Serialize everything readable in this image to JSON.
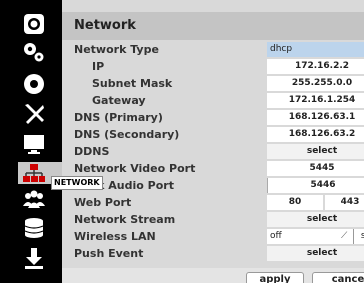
{
  "sidebar": {
    "tooltip": "NETWORK",
    "icons": [
      "camera-icon",
      "gears-icon",
      "record-icon",
      "tools-icon",
      "monitor-icon",
      "network-icon",
      "users-icon",
      "storage-icon",
      "download-icon"
    ]
  },
  "panel": {
    "title": "Network",
    "rows": [
      {
        "label": "Network Type",
        "value": "dhcp"
      },
      {
        "label": "IP",
        "value": "172.16.2.2"
      },
      {
        "label": "Subnet Mask",
        "value": "255.255.0.0"
      },
      {
        "label": "Gateway",
        "value": "172.16.1.254"
      },
      {
        "label": "DNS (Primary)",
        "value": "168.126.63.1"
      },
      {
        "label": "DNS (Secondary)",
        "value": "168.126.63.2"
      },
      {
        "label": "DDNS",
        "value": "select"
      },
      {
        "label": "Network Video Port",
        "value": "5445"
      },
      {
        "label": "work Audio Port",
        "value": "5446"
      },
      {
        "label": "Web Port",
        "value": "80",
        "value2": "443"
      },
      {
        "label": "Network Stream",
        "value": "select"
      },
      {
        "label": "Wireless LAN",
        "value": "off",
        "value2": "se"
      },
      {
        "label": "Push Event",
        "value": "select"
      }
    ],
    "buttons": {
      "apply": "apply",
      "cancel": "cance"
    }
  }
}
